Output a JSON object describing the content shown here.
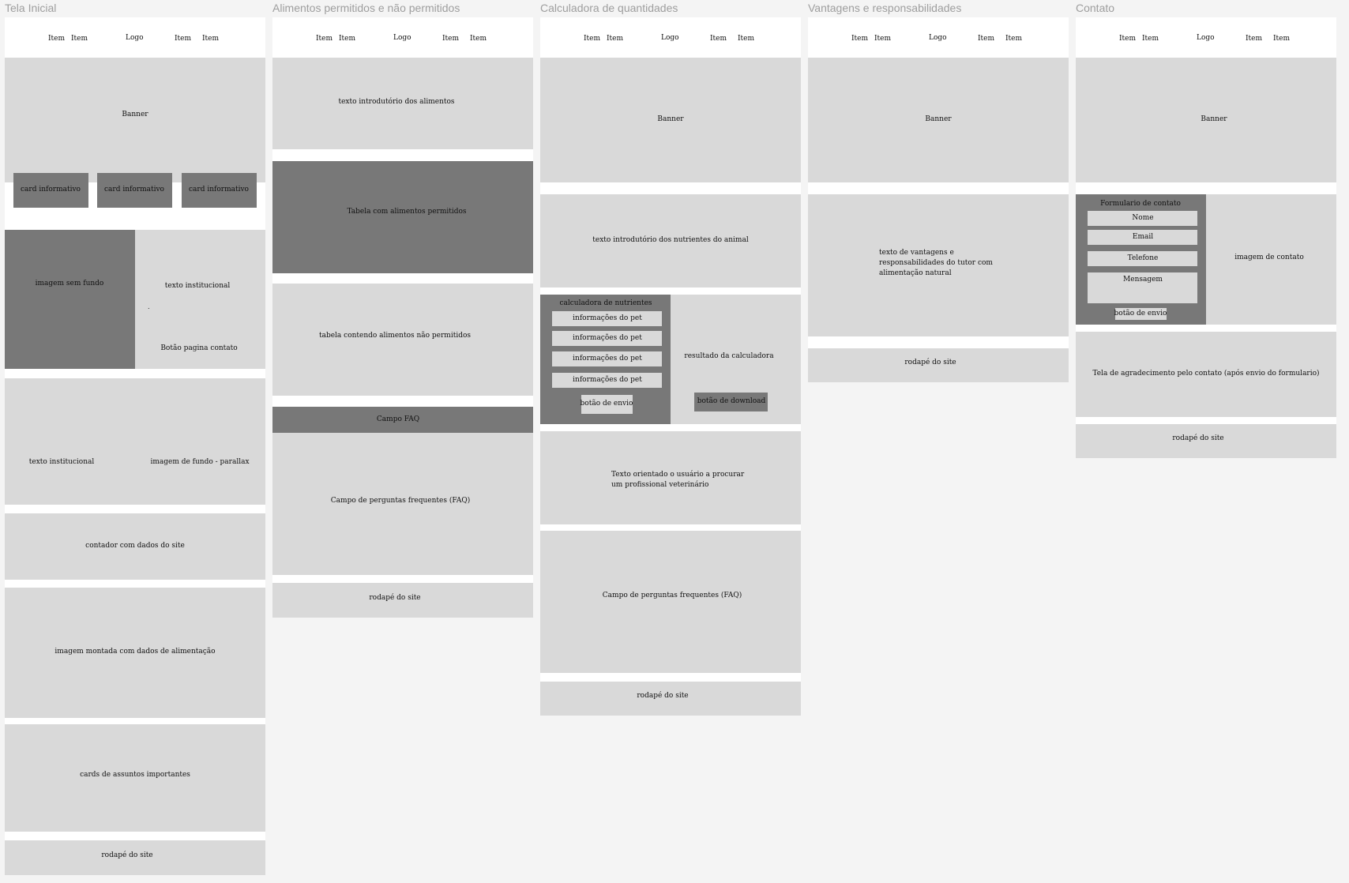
{
  "frames": [
    {
      "title": "Tela Inicial",
      "nav": {
        "item1": "Item",
        "item2": "Item",
        "logo": "Logo",
        "item3": "Item",
        "item4": "Item"
      },
      "banner": "Banner",
      "cards": [
        "card informativo",
        "card informativo",
        "card informativo"
      ],
      "image_no_bg": "imagem sem fundo",
      "institutional_text": "texto institucional",
      "dot": ".",
      "contact_button": "Botão pagina contato",
      "institutional_text_2": "texto institucional",
      "parallax_image": "imagem de fundo - parallax",
      "counter": "contador com dados do site",
      "feeding_image": "imagem montada com  dados de alimentação",
      "important_cards": "cards de assuntos importantes",
      "footer": "rodapé do site"
    },
    {
      "title": "Alimentos permitidos e não permitidos",
      "nav": {
        "item1": "Item",
        "item2": "Item",
        "logo": "Logo",
        "item3": "Item",
        "item4": "Item"
      },
      "intro_text": "texto introdutório dos alimentos",
      "allowed_table": "Tabela com alimentos permitidos",
      "forbidden_table": "tabela contendo alimentos não permitidos",
      "faq_header": "Campo FAQ",
      "faq_field": "Campo de perguntas frequentes (FAQ)",
      "footer": "rodapé do site"
    },
    {
      "title": "Calculadora de quantidades",
      "nav": {
        "item1": "Item",
        "item2": "Item",
        "logo": "Logo",
        "item3": "Item",
        "item4": "Item"
      },
      "banner": "Banner",
      "intro_text": "texto introdutório dos nutrientes do animal",
      "calculator_title": "calculadora de nutrientes",
      "pet_fields": [
        "informações do pet",
        "informações do pet",
        "informações do pet",
        "informações do pet"
      ],
      "submit_button": "botão de envio",
      "result_text": "resultado da calculadora",
      "download_button": "botão de download",
      "vet_text_line1": "Texto orientado o usuário a procurar",
      "vet_text_line2": "um profissional veterinário",
      "faq_field": "Campo de perguntas frequentes (FAQ)",
      "footer": "rodapé do site"
    },
    {
      "title": "Vantagens e responsabilidades",
      "nav": {
        "item1": "Item",
        "item2": "Item",
        "logo": "Logo",
        "item3": "Item",
        "item4": "Item"
      },
      "banner": "Banner",
      "text_line1": "texto de vantagens e",
      "text_line2": "responsabilidades do tutor com",
      "text_line3": "alimentação natural",
      "footer": "rodapé do site"
    },
    {
      "title": "Contato",
      "nav": {
        "item1": "Item",
        "item2": "Item",
        "logo": "Logo",
        "item3": "Item",
        "item4": "Item"
      },
      "banner": "Banner",
      "form_title": "Formulario de contato",
      "name_field": "Nome",
      "email_field": "Email",
      "phone_field": "Telefone",
      "message_field": "Mensagem",
      "submit_button": "botão de envio",
      "contact_image": "imagem de contato",
      "thanks_screen": "Tela de agradecimento pelo contato (após envio do formulario)",
      "footer": "rodapé do site"
    }
  ],
  "colors": {
    "canvas": "#f4f4f4",
    "light_block": "#d9d9d9",
    "dark_block": "#787878",
    "frame_title": "#9e9e9e"
  }
}
